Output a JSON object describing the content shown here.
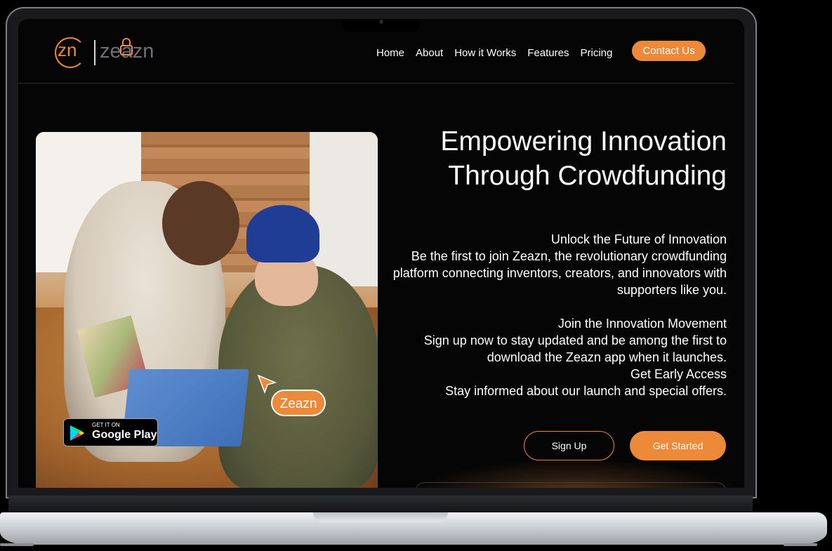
{
  "brand": {
    "mark": "zn",
    "name": "zeazn",
    "accent": "#ec8a3a"
  },
  "nav": {
    "items": [
      {
        "label": "Home"
      },
      {
        "label": "About"
      },
      {
        "label": "How it Works"
      },
      {
        "label": "Features"
      },
      {
        "label": "Pricing"
      }
    ],
    "contact_label": "Contact Us"
  },
  "hero": {
    "headline_line1": "Empowering Innovation",
    "headline_line2": "Through Crowdfunding",
    "paragraphs": [
      "Unlock the Future of Innovation",
      "Be the first to join Zeazn, the revolutionary crowdfunding platform connecting inventors, creators, and innovators with supporters like you.",
      "Join the Innovation Movement",
      "Sign up now to stay updated and be among the first to download the Zeazn app when it launches.",
      "Get Early Access",
      "Stay informed about our launch and special offers."
    ],
    "signup_label": "Sign Up",
    "get_started_label": "Get Started"
  },
  "image": {
    "tag_label": "Zeazn",
    "store_badge_small": "GET IT ON",
    "store_badge_big": "Google Play",
    "icons": [
      "cursor-icon",
      "google-play-icon",
      "lock-icon"
    ]
  }
}
